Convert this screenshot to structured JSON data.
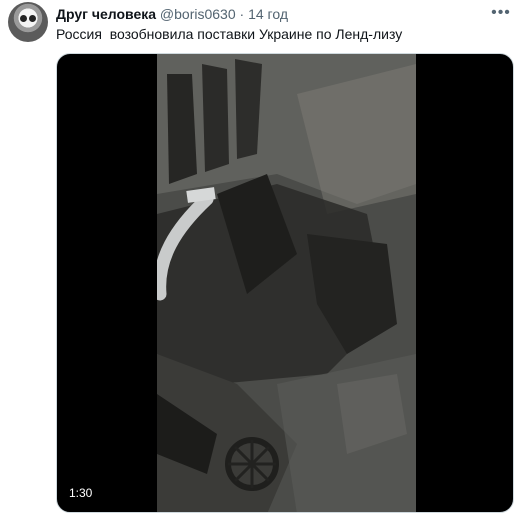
{
  "tweet": {
    "display_name": "Друг человека",
    "handle": "@boris0630",
    "separator": "·",
    "time": "14 год",
    "text": "Россия  возобновила поставки Украине по Ленд-лизу",
    "more_icon": "more-horizontal-icon",
    "video": {
      "duration": "1:30"
    }
  }
}
